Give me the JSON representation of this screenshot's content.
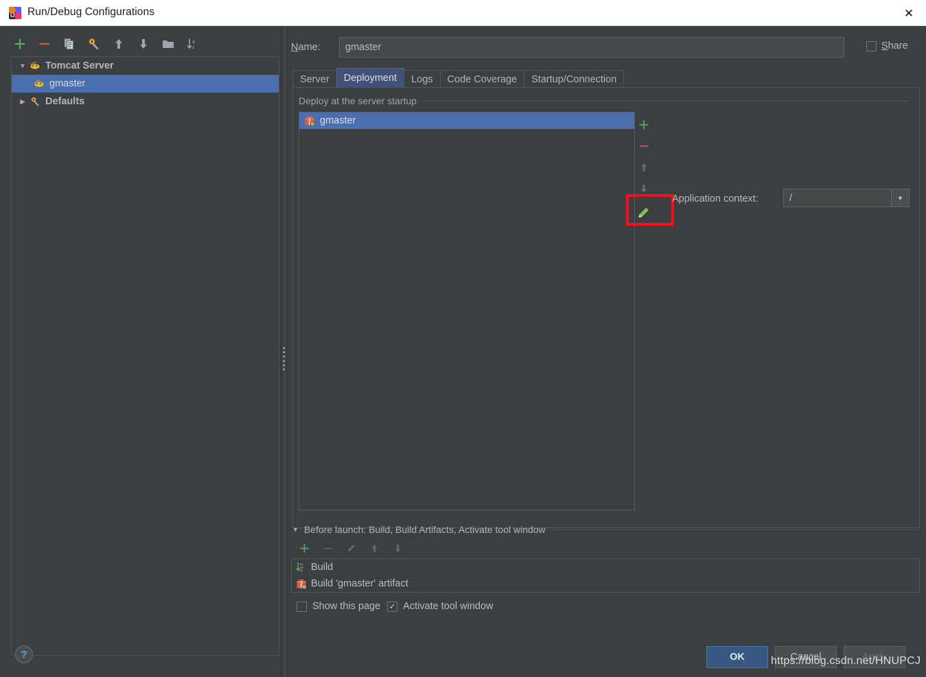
{
  "window": {
    "title": "Run/Debug Configurations",
    "app_icon": "intellij-idea-icon",
    "close_label": "✕"
  },
  "left_panel": {
    "toolbar": [
      {
        "name": "add-configuration-button",
        "icon": "plus-icon",
        "glyph": "+"
      },
      {
        "name": "remove-configuration-button",
        "icon": "minus-icon",
        "glyph": "–"
      },
      {
        "name": "copy-configuration-button",
        "icon": "copy-icon",
        "glyph": "⧉"
      },
      {
        "name": "edit-defaults-button",
        "icon": "wrench-icon",
        "glyph": "🔧"
      },
      {
        "name": "move-up-button",
        "icon": "arrow-up-icon",
        "glyph": "↑"
      },
      {
        "name": "move-down-button",
        "icon": "arrow-down-icon",
        "glyph": "↓"
      },
      {
        "name": "new-folder-button",
        "icon": "folder-icon",
        "glyph": "📁"
      },
      {
        "name": "sort-alphabetically-button",
        "icon": "sort-az-icon",
        "glyph": "↓az"
      }
    ],
    "tree": [
      {
        "label": "Tomcat Server",
        "level": 0,
        "arrow": "▼",
        "icon": "tomcat-icon",
        "selected": false,
        "group": true
      },
      {
        "label": "gmaster",
        "level": 1,
        "arrow": "",
        "icon": "tomcat-icon",
        "selected": true,
        "group": false
      },
      {
        "label": "Defaults",
        "level": 0,
        "arrow": "▶",
        "icon": "wrench-icon",
        "selected": false,
        "group": true
      }
    ],
    "help_label": "?"
  },
  "main": {
    "name_label": "Name:",
    "name_mnemonic": "N",
    "name_value": "gmaster",
    "share": {
      "label": "Share",
      "mnemonic": "S",
      "checked": false
    },
    "tabs": [
      {
        "label": "Server",
        "active": false
      },
      {
        "label": "Deployment",
        "active": true
      },
      {
        "label": "Logs",
        "active": false
      },
      {
        "label": "Code Coverage",
        "active": false
      },
      {
        "label": "Startup/Connection",
        "active": false
      }
    ],
    "deploy_section_label": "Deploy at the server startup",
    "deploy_items": [
      {
        "label": "gmaster",
        "icon": "artifact-icon",
        "selected": true
      }
    ],
    "list_toolbar": [
      {
        "name": "add-artifact-button",
        "icon": "plus-icon",
        "glyph": "+",
        "dim": false
      },
      {
        "name": "remove-artifact-button",
        "icon": "minus-icon",
        "glyph": "–",
        "dim": false
      },
      {
        "name": "move-artifact-up-button",
        "icon": "arrow-up-icon",
        "glyph": "↑",
        "dim": true
      },
      {
        "name": "move-artifact-down-button",
        "icon": "arrow-down-icon",
        "glyph": "↓",
        "dim": true
      },
      {
        "name": "edit-artifact-button",
        "icon": "pencil-icon",
        "glyph": "✎",
        "dim": false
      }
    ],
    "app_context_label": "Application context:",
    "app_context_value": "/",
    "app_context_arrow": "▼",
    "highlight_color": "#fc0d1c",
    "highlight_target": "edit-artifact-button"
  },
  "before_launch": {
    "triangle": "▼",
    "title": "Before launch: Build, Build Artifacts, Activate tool window",
    "mnemonic": "B",
    "toolbar": [
      {
        "name": "add-before-launch-task-button",
        "icon": "plus-icon",
        "glyph": "+",
        "dim": false
      },
      {
        "name": "remove-before-launch-task-button",
        "icon": "minus-icon",
        "glyph": "–",
        "dim": true
      },
      {
        "name": "edit-before-launch-task-button",
        "icon": "pencil-icon",
        "glyph": "✎",
        "dim": true
      },
      {
        "name": "move-task-up-button",
        "icon": "arrow-up-icon",
        "glyph": "↑",
        "dim": true
      },
      {
        "name": "move-task-down-button",
        "icon": "arrow-down-icon",
        "glyph": "↓",
        "dim": true
      }
    ],
    "tasks": [
      {
        "label": "Build",
        "icon": "build-icon"
      },
      {
        "label": "Build 'gmaster' artifact",
        "icon": "artifact-icon"
      }
    ],
    "checkboxes": [
      {
        "label": "Show this page",
        "checked": false,
        "name": "show-this-page-checkbox"
      },
      {
        "label": "Activate tool window",
        "checked": true,
        "name": "activate-tool-window-checkbox"
      }
    ]
  },
  "footer": {
    "ok_label": "OK",
    "cancel_label": "Cancel",
    "apply_label": "Apply",
    "apply_disabled": true,
    "watermark": "https://blog.csdn.net/HNUPCJ"
  }
}
